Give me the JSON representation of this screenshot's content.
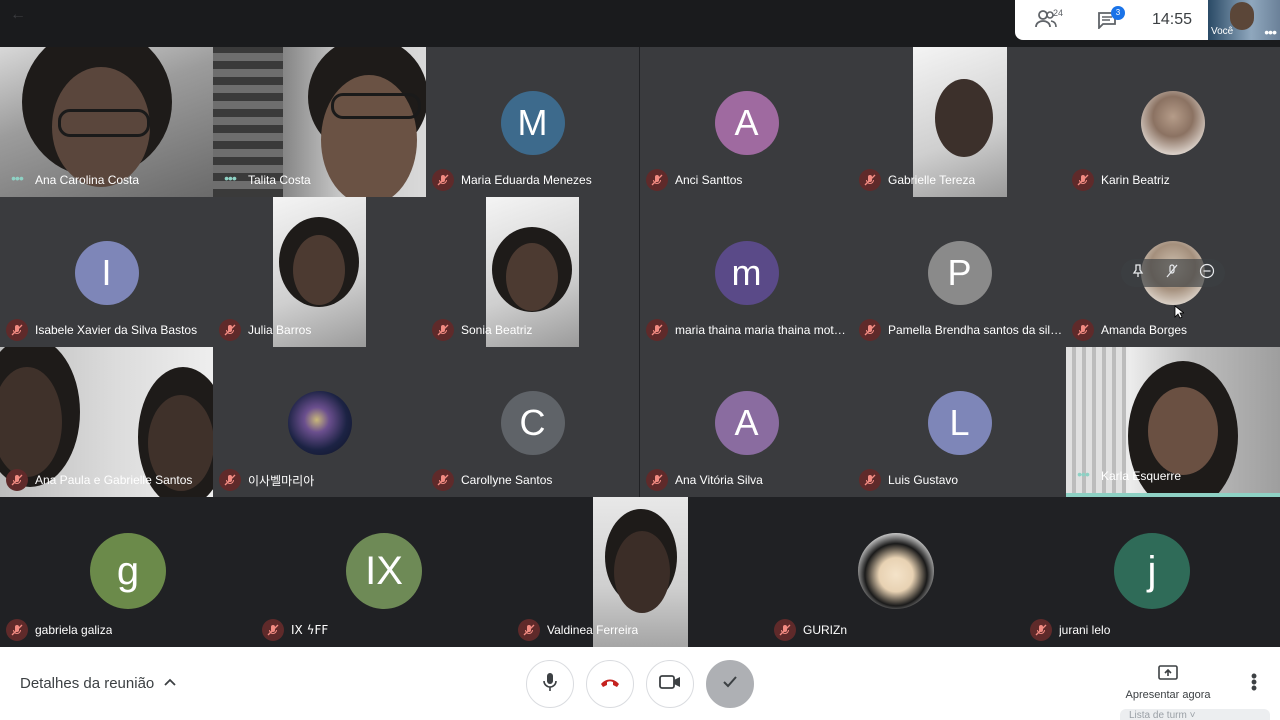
{
  "topbar": {
    "people_count": "24",
    "chat_badge": "3",
    "time": "14:55",
    "self_label": "Você"
  },
  "participants": [
    {
      "name": "Ana Carolina Costa",
      "status": "speaking-dots",
      "kind": "video"
    },
    {
      "name": "Talita Costa",
      "status": "speaking-dots",
      "kind": "video"
    },
    {
      "name": "Maria Eduarda Menezes",
      "status": "muted",
      "kind": "avatar",
      "letter": "M",
      "color": "#3d6a8c"
    },
    {
      "name": "Anci Santtos",
      "status": "muted",
      "kind": "avatar",
      "letter": "A",
      "color": "#9f6aa0"
    },
    {
      "name": "Gabrielle Tereza",
      "status": "muted",
      "kind": "video"
    },
    {
      "name": "Karin Beatriz",
      "status": "muted",
      "kind": "photo"
    },
    {
      "name": "Isabele Xavier da Silva Bastos",
      "status": "muted",
      "kind": "avatar",
      "letter": "I",
      "color": "#7e86b8"
    },
    {
      "name": "Julia Barros",
      "status": "muted",
      "kind": "video"
    },
    {
      "name": "Sonia Beatriz",
      "status": "muted",
      "kind": "video"
    },
    {
      "name": "maria thaina maria thaina mota ...",
      "status": "muted",
      "kind": "avatar",
      "letter": "m",
      "color": "#5a4a88"
    },
    {
      "name": "Pamella Brendha santos da silva...",
      "status": "muted",
      "kind": "avatar",
      "letter": "P",
      "color": "#8a8a8a"
    },
    {
      "name": "Amanda Borges",
      "status": "muted",
      "kind": "photo"
    },
    {
      "name": "Ana Paula e Gabrielle Santos",
      "status": "muted",
      "kind": "video"
    },
    {
      "name": "이사벨마리아",
      "status": "muted",
      "kind": "photo"
    },
    {
      "name": "Carollyne Santos",
      "status": "muted",
      "kind": "avatar",
      "letter": "C",
      "color": "#5f6368"
    },
    {
      "name": "Ana Vitória Silva",
      "status": "muted",
      "kind": "avatar",
      "letter": "A",
      "color": "#8a6ca0"
    },
    {
      "name": "Luis Gustavo",
      "status": "muted",
      "kind": "avatar",
      "letter": "L",
      "color": "#7e86b8"
    },
    {
      "name": "Karla Esquerre",
      "status": "speaking-dots",
      "kind": "video"
    },
    {
      "name": "gabriela galiza",
      "status": "muted",
      "kind": "avatar",
      "letter": "g",
      "color": "#6b8a4a"
    },
    {
      "name": "IX ϟFF",
      "status": "muted",
      "kind": "avatar",
      "letter": "IX",
      "color": "#6e8a56"
    },
    {
      "name": "Valdinea Ferreira",
      "status": "muted",
      "kind": "video"
    },
    {
      "name": "GURIZn",
      "status": "muted",
      "kind": "photo"
    },
    {
      "name": "jurani lelo",
      "status": "muted",
      "kind": "avatar",
      "letter": "j",
      "color": "#2f6b58"
    }
  ],
  "bottombar": {
    "details_label": "Detalhes da reunião",
    "present_label": "Apresentar agora",
    "list_label": "Lista de turm"
  },
  "colors": {
    "muted_badge": "#5f2a2a",
    "speaking_dots": "#8ed1c4",
    "accent_blue": "#1a73e8"
  }
}
